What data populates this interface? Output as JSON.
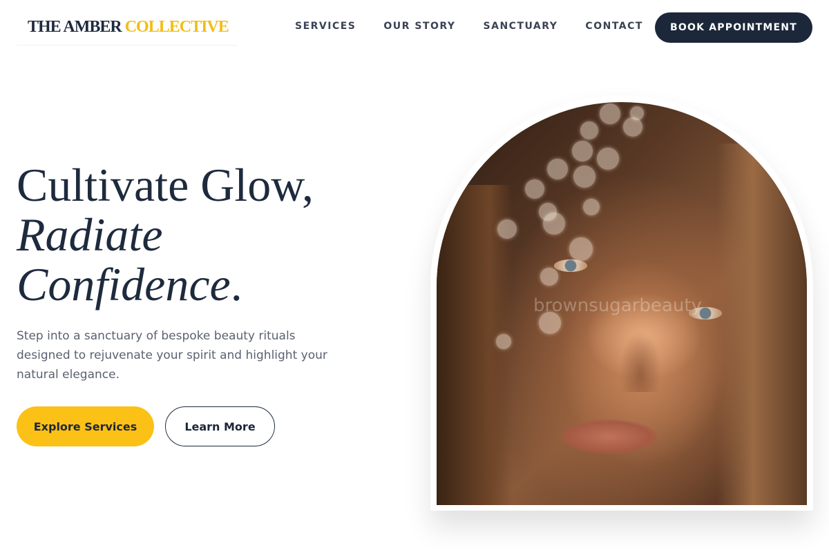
{
  "brand": {
    "part1": "THE AMBER",
    "part2": "COLLECTIVE"
  },
  "nav": {
    "items": [
      {
        "label": "SERVICES"
      },
      {
        "label": "OUR STORY"
      },
      {
        "label": "SANCTUARY"
      },
      {
        "label": "CONTACT"
      }
    ],
    "cta_label": "BOOK APPOINTMENT"
  },
  "hero": {
    "headline_line1": "Cultivate Glow,",
    "headline_line2": "Radiate",
    "headline_line3": "Confidence",
    "headline_line3_suffix": ".",
    "subtext": "Step into a sanctuary of bespoke beauty rituals designed to rejuvenate your spirit and highlight your natural elegance.",
    "primary_button": "Explore Services",
    "secondary_button": "Learn More"
  },
  "image": {
    "icon": "portrait-photo",
    "watermark": "brownsugarbeauty"
  },
  "colors": {
    "accent": "#fcc116",
    "navy": "#1c273a",
    "text_muted": "#5a6170"
  }
}
